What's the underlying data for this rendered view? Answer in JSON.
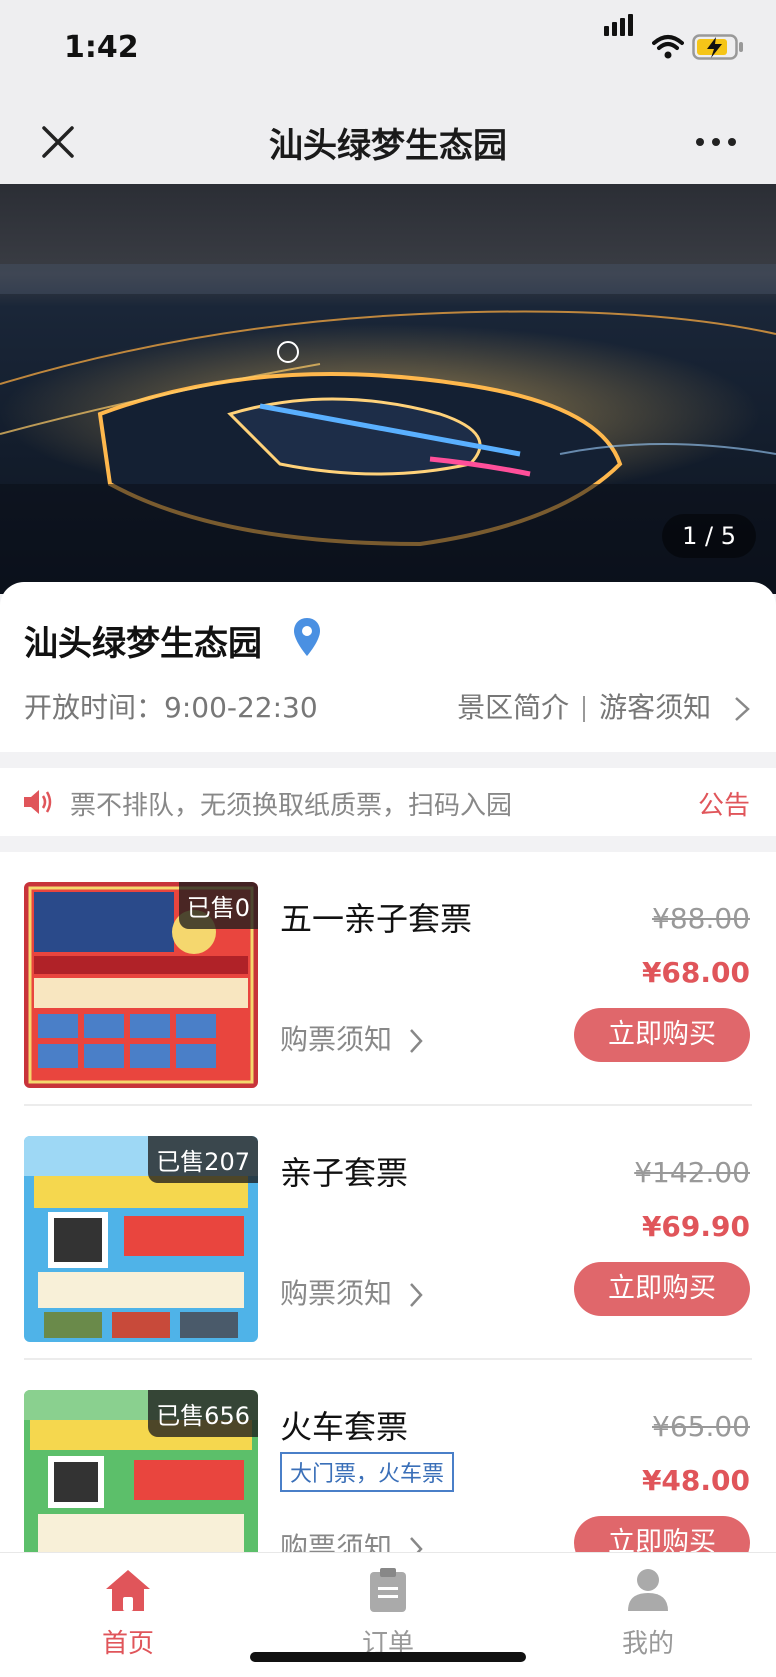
{
  "status_bar": {
    "time": "1:42"
  },
  "nav": {
    "title": "汕头绿梦生态园"
  },
  "hero": {
    "counter": "1 / 5"
  },
  "info": {
    "name": "汕头绿梦生态园",
    "hours_label": "开放时间：",
    "hours_value": "9:00-22:30",
    "intro_link": "景区简介",
    "notice_link": "游客须知"
  },
  "announcement": {
    "text": "票不排队，无须换取纸质票，扫码入园",
    "link": "公告"
  },
  "products": [
    {
      "sold": "已售0",
      "name": "五一亲子套票",
      "original_price": "¥88.00",
      "price": "¥68.00",
      "note": "购票须知",
      "buy": "立即购买"
    },
    {
      "sold": "已售207",
      "name": "亲子套票",
      "original_price": "¥142.00",
      "price": "¥69.90",
      "note": "购票须知",
      "buy": "立即购买"
    },
    {
      "sold": "已售656",
      "name": "火车套票",
      "tag": "大门票，火车票",
      "original_price": "¥65.00",
      "price": "¥48.00",
      "note": "购票须知",
      "buy": "立即购买"
    }
  ],
  "tabbar": [
    {
      "label": "首页",
      "active": true
    },
    {
      "label": "订单",
      "active": false
    },
    {
      "label": "我的",
      "active": false
    }
  ],
  "colors": {
    "accent": "#e0555a",
    "button": "#e0676b",
    "tag_border": "#4a7fc8"
  }
}
